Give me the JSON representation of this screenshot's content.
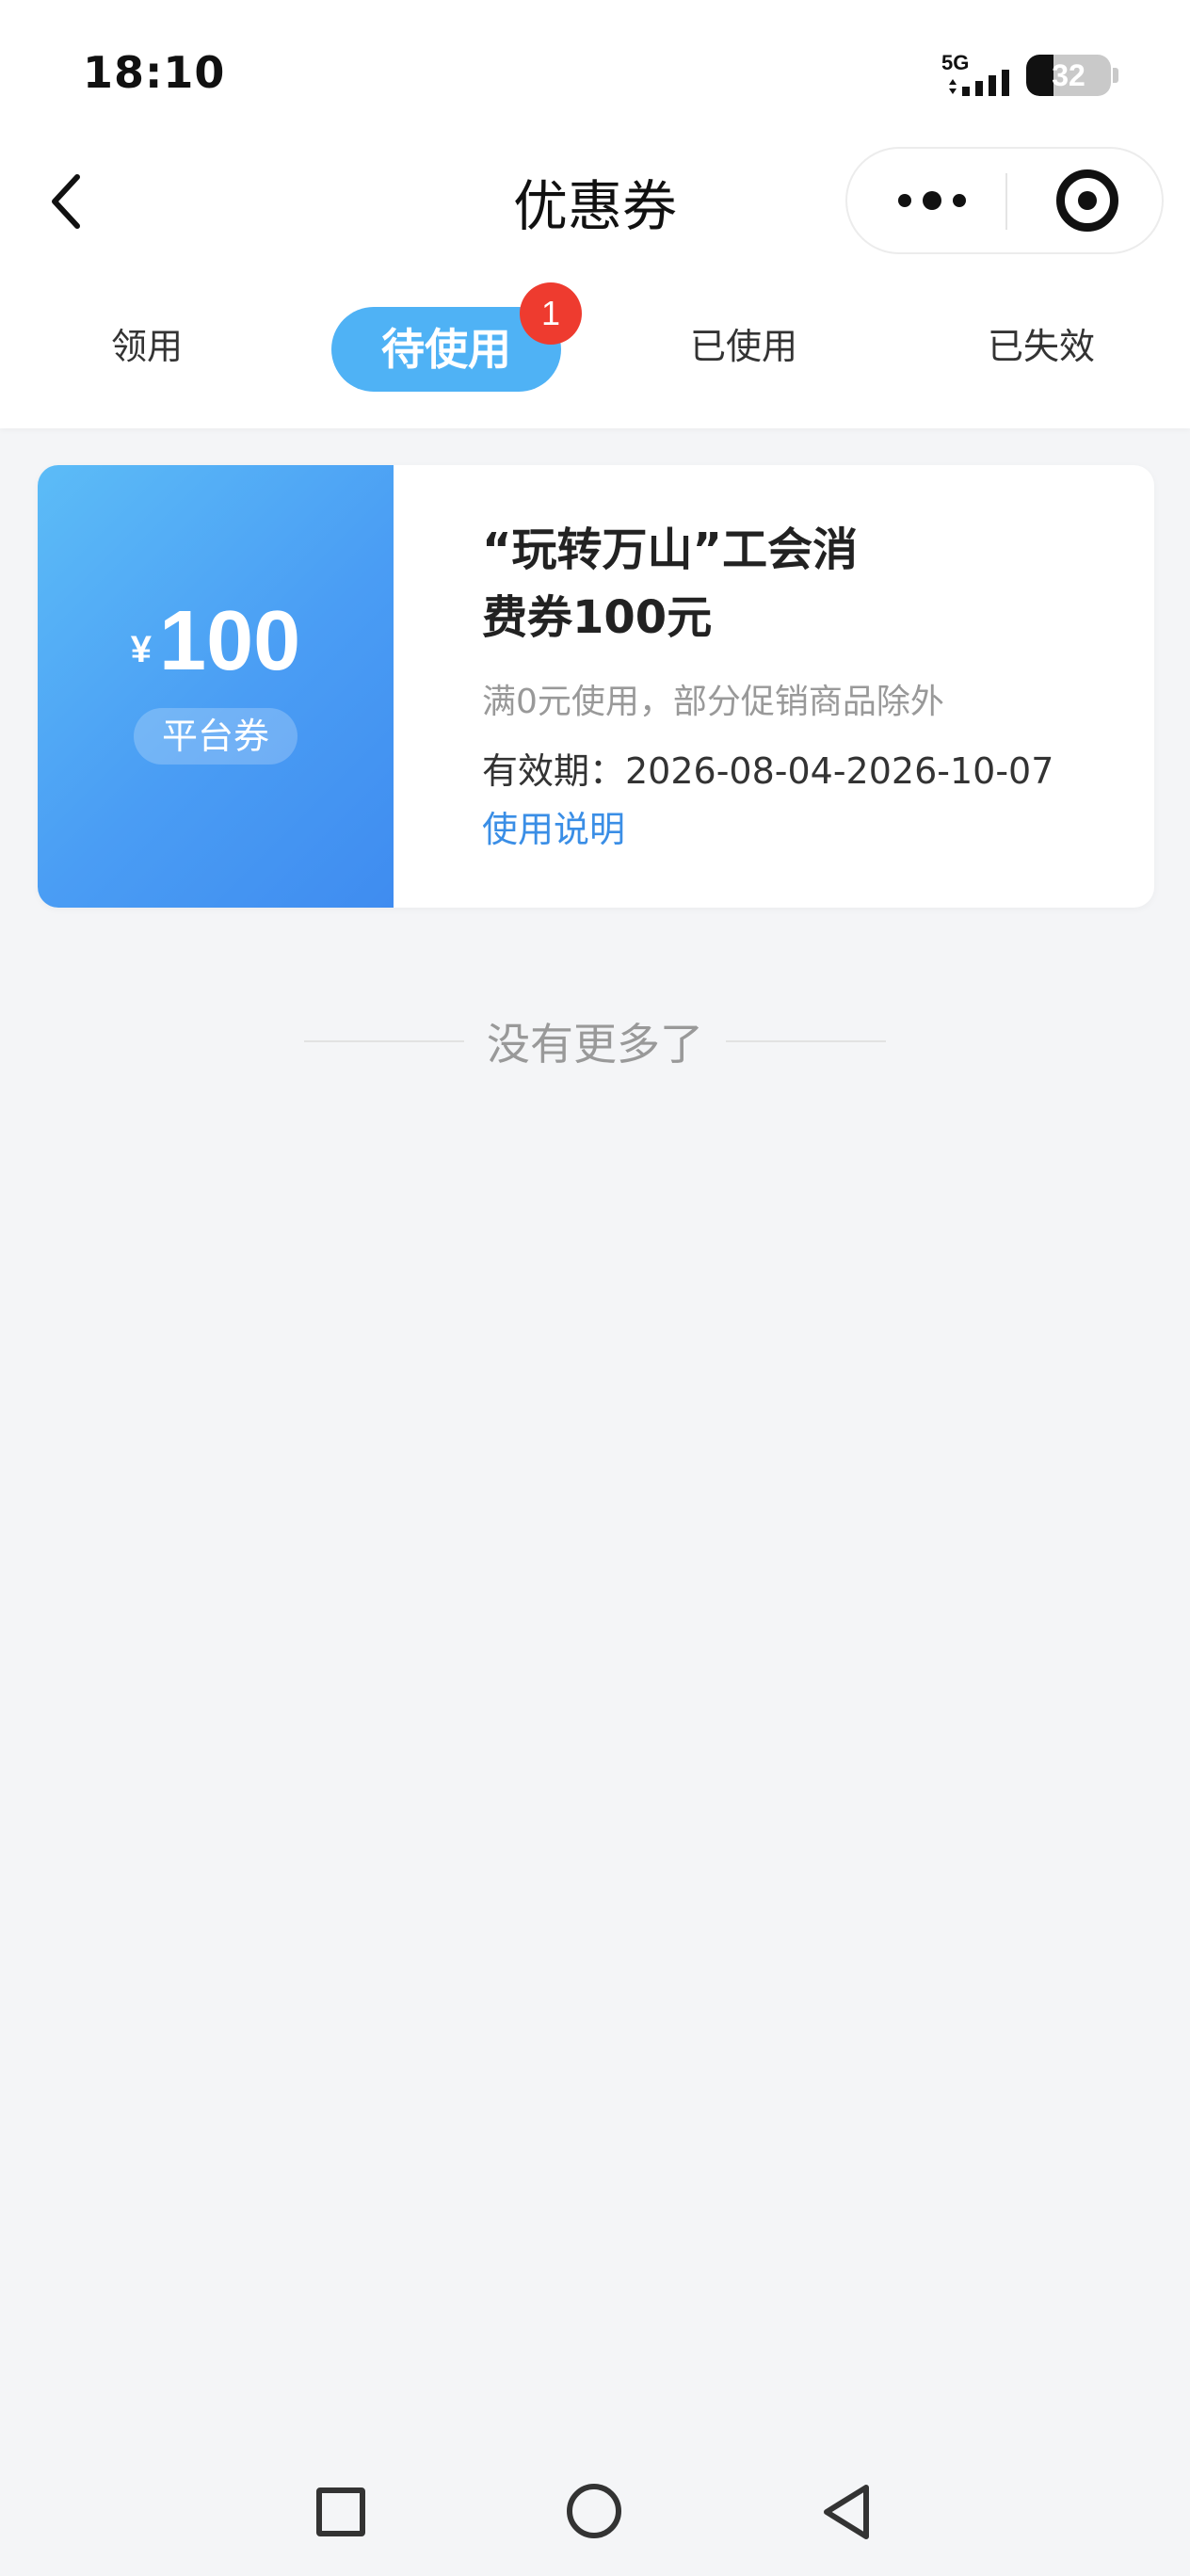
{
  "status_bar": {
    "time": "18:10",
    "network": "5G",
    "battery": "32",
    "battery_level": 32
  },
  "nav": {
    "title": "优惠券",
    "back_icon": "chevron-left-icon",
    "more_icon": "more-dots-icon",
    "close_icon": "target-close-icon"
  },
  "tabs": [
    {
      "label": "领用"
    },
    {
      "label": "待使用",
      "active": true,
      "badge": "1"
    },
    {
      "label": "已使用"
    },
    {
      "label": "已失效"
    }
  ],
  "coupon": {
    "currency": "¥",
    "amount": "100",
    "tag": "平台券",
    "title": "“玩转万山”工会消费券100元",
    "condition": "满0元使用，部分促销商品除外",
    "validity": "有效期：2026-08-04-2026-10-07",
    "instructions_link": "使用说明"
  },
  "footer": {
    "no_more": "没有更多了"
  },
  "colors": {
    "accent": "#4fb2f5",
    "badge": "#ee3b2f",
    "link": "#3a8ee6",
    "coupon_gradient_start": "#5cbcf7",
    "coupon_gradient_end": "#3f8cf0",
    "background": "#f4f5f7"
  },
  "system_nav": {
    "recents_icon": "square-icon",
    "home_icon": "circle-icon",
    "back_icon": "triangle-back-icon"
  }
}
